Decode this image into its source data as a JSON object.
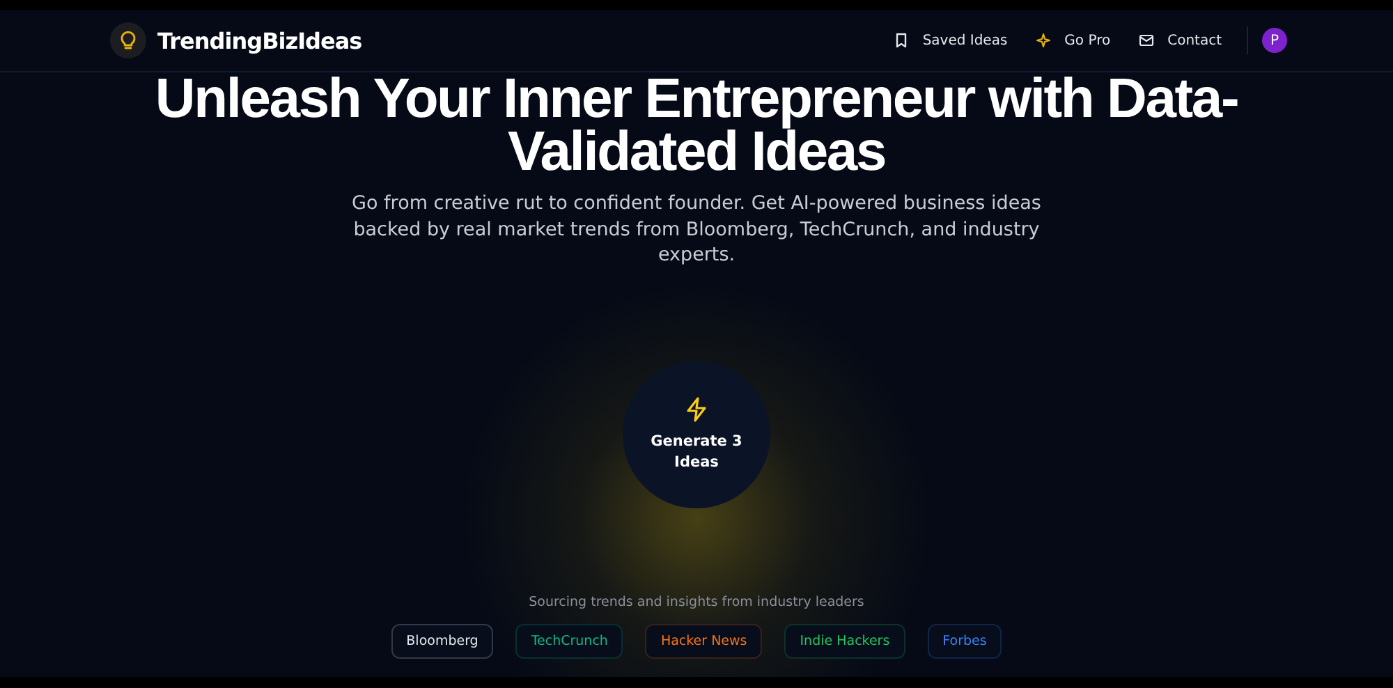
{
  "brand": {
    "name": "TrendingBizIdeas"
  },
  "nav": [
    {
      "label": "Saved Ideas",
      "kind": "bookmark"
    },
    {
      "label": "Go Pro",
      "kind": "sparkle"
    },
    {
      "label": "Contact",
      "kind": "mail"
    }
  ],
  "avatar": {
    "initial": "P"
  },
  "hero": {
    "title": "Unleash Your Inner Entrepreneur with Data-Validated Ideas",
    "subtitle": "Go from creative rut to confident founder. Get AI-powered business ideas backed by real market trends from Bloomberg, TechCrunch, and industry experts."
  },
  "generate_button": {
    "label": "Generate 3 Ideas"
  },
  "sources": {
    "caption": "Sourcing trends and insights from industry leaders",
    "items": [
      {
        "label": "Bloomberg",
        "color": "#e5e7eb"
      },
      {
        "label": "TechCrunch",
        "color": "#10b981"
      },
      {
        "label": "Hacker News",
        "color": "#f97316"
      },
      {
        "label": "Indie Hackers",
        "color": "#22c55e"
      },
      {
        "label": "Forbes",
        "color": "#3b82f6"
      }
    ]
  }
}
